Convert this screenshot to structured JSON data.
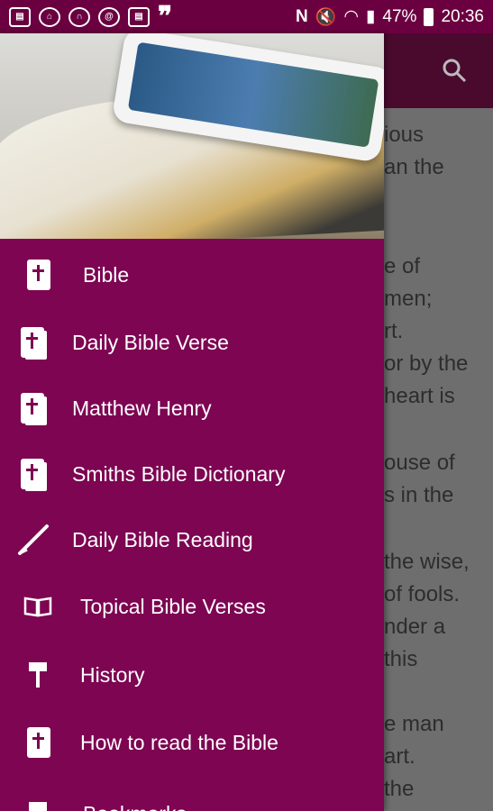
{
  "status_bar": {
    "icons": [
      "bible-app-icon",
      "church-icon",
      "headphones-icon",
      "at-sign-icon",
      "bible-app-icon-2",
      "quote-icon"
    ],
    "nfc_icon": "nfc-icon",
    "mute_icon": "mute-icon",
    "wifi_icon": "wifi-icon",
    "battery_percent": "47%",
    "time": "20:36"
  },
  "toolbar": {
    "search_icon": "search-icon"
  },
  "background_text": [
    "ious",
    "an the",
    "e of",
    "men;",
    "rt.",
    "or by the",
    "heart is",
    "ouse of",
    "s in the",
    "the wise,",
    "of fools.",
    "nder a",
    "this",
    "e man",
    "art.",
    "the"
  ],
  "drawer": {
    "items": [
      {
        "label": "Bible",
        "icon": "bible-icon"
      },
      {
        "label": "Daily Bible Verse",
        "icon": "bible-book-icon"
      },
      {
        "label": "Matthew Henry",
        "icon": "bible-book-icon"
      },
      {
        "label": "Smiths Bible Dictionary",
        "icon": "bible-book-icon"
      },
      {
        "label": "Daily Bible Reading",
        "icon": "pen-icon"
      },
      {
        "label": "Topical Bible Verses",
        "icon": "open-book-icon"
      },
      {
        "label": "History",
        "icon": "paint-roller-icon"
      },
      {
        "label": "How to read the Bible",
        "icon": "bible-icon"
      },
      {
        "label": "Bookmarks",
        "icon": "bookmark-icon"
      }
    ]
  },
  "colors": {
    "drawer_bg": "#7d0552",
    "status_bar_bg": "#6b0040",
    "text": "#ffffff"
  }
}
